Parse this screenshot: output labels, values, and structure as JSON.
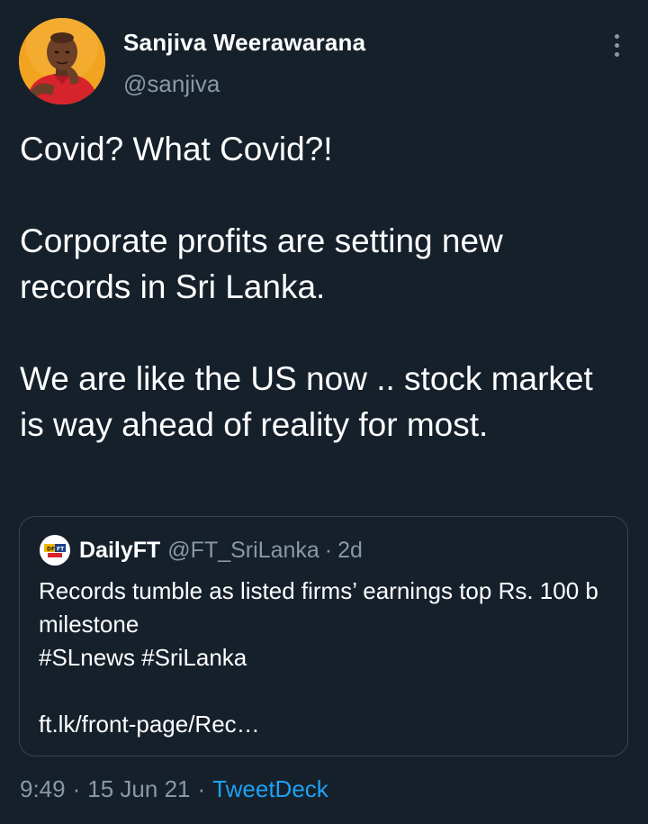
{
  "author": {
    "name": "Sanjiva Weerawarana",
    "handle": "@sanjiva"
  },
  "tweet": {
    "paragraphs": [
      "Covid? What Covid?!",
      "Corporate profits are setting new records in Sri Lanka.",
      "We are like the US now .. stock market is way ahead of reality for most."
    ]
  },
  "quoted_tweet": {
    "name": "DailyFT",
    "handle": "@FT_SriLanka",
    "separator": "·",
    "time": "2d",
    "avatar_text": "DailyFT",
    "lines": [
      "Records tumble as listed firms’ earnings top Rs. 100 b milestone",
      "#SLnews #SriLanka"
    ],
    "link": "ft.lk/front-page/Rec…"
  },
  "footer": {
    "time": "9:49",
    "separator": "·",
    "date": "15 Jun 21",
    "source": "TweetDeck"
  },
  "colors": {
    "background": "#15202b",
    "secondary_text": "#8899a6",
    "link": "#1da1f2",
    "border": "#38444d"
  },
  "icons": {
    "more": "more-vertical-icon",
    "avatar": "profile-photo",
    "quote_avatar": "dailyft-logo"
  }
}
